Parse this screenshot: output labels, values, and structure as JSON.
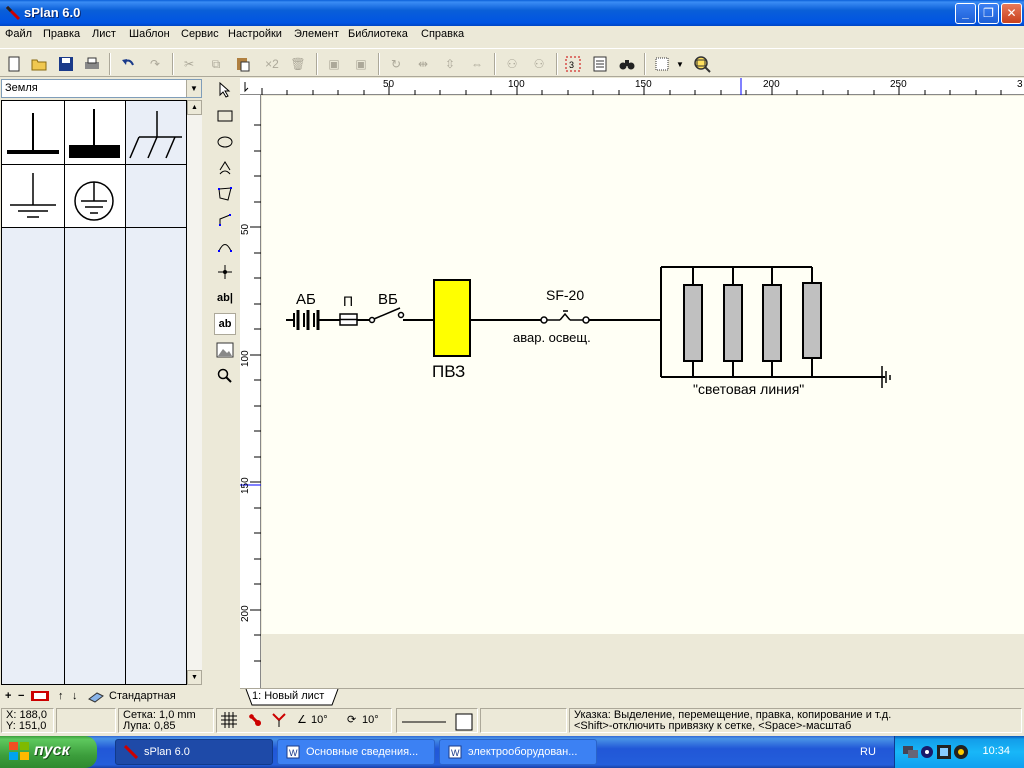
{
  "window": {
    "title": "sPlan 6.0",
    "minimize": "_",
    "maximize": "❐",
    "close": "✕"
  },
  "menu": [
    "Файл",
    "Правка",
    "Лист",
    "Шаблон",
    "Сервис",
    "Настройки",
    "Элемент",
    "Библиотека",
    "Справка"
  ],
  "toolbar": {
    "multiply_label": "×2"
  },
  "library": {
    "category": "Земля",
    "style_label": "Стандартная"
  },
  "ruler": {
    "top_ticks": [
      "50",
      "100",
      "150",
      "200",
      "250",
      "3"
    ],
    "left_ticks": [
      "50",
      "100",
      "150",
      "200"
    ]
  },
  "schematic": {
    "battery_label": "АБ",
    "fuse_label": "П",
    "switch_label": "ВБ",
    "box_label": "ПВЗ",
    "breaker_label": "SF-20",
    "breaker_caption": "авар. освещ.",
    "line_label": "\"световая линия\"",
    "box_color": "#ffff00",
    "lamp_color": "#c0c0c0"
  },
  "sheet_tab": "1: Новый лист",
  "status": {
    "x": "X: 188,0",
    "y": "Y: 151,0",
    "grid": "Сетка:  1,0 mm",
    "zoom": "Лупа:   0,85",
    "angle1": "10°",
    "angle2": "10°",
    "hint1": "Указка: Выделение, перемещение, правка, копирование и т.д.",
    "hint2": "<Shift>-отключить привязку к сетке, <Space>-масштаб"
  },
  "taskbar": {
    "start": "пуск",
    "tasks": [
      "sPlan 6.0",
      "Основные сведения...",
      "электрооборудован..."
    ],
    "language": "RU",
    "clock": "10:34"
  }
}
